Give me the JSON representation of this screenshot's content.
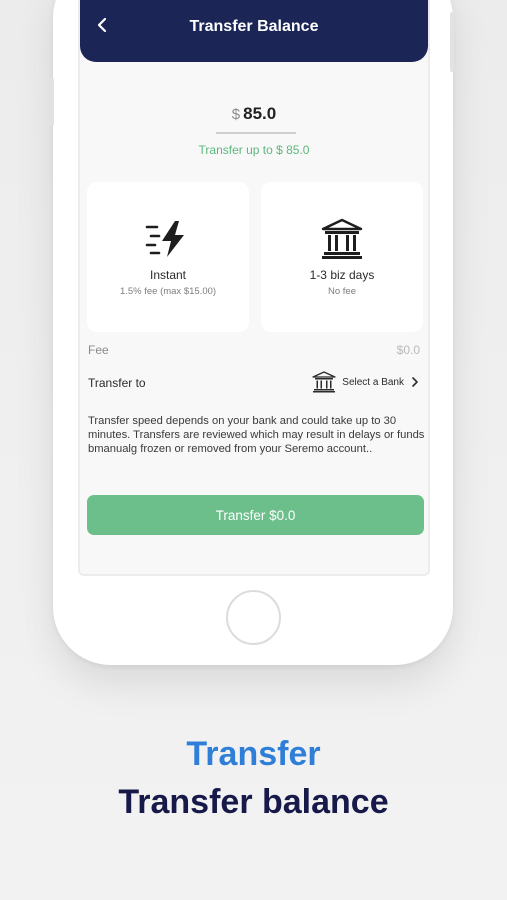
{
  "header": {
    "title": "Transfer Balance",
    "back_icon": "chevron-left-icon"
  },
  "amount": {
    "currency": "$",
    "value": "85.0",
    "limit_text": "Transfer up to $ 85.0"
  },
  "options": [
    {
      "icon": "lightning-speed-icon",
      "title": "Instant",
      "subtitle": "1.5% fee (max $15.00)"
    },
    {
      "icon": "bank-icon",
      "title": "1-3 biz days",
      "subtitle": "No fee"
    }
  ],
  "fee": {
    "label": "Fee",
    "value": "$0.0"
  },
  "transfer_to": {
    "label": "Transfer to",
    "select_label": "Select a Bank",
    "icon": "bank-icon"
  },
  "notice": "Transfer speed depends on your bank and could take up to 30 minutes. Transfers are reviewed which may result in delays or funds bmanualg frozen or removed from your Seremo account..",
  "transfer_button": {
    "label": "Transfer $0.0"
  },
  "captions": {
    "line1": "Transfer",
    "line2": "Transfer balance"
  },
  "colors": {
    "header": "#1b2657",
    "accent_green": "#6cbf8a",
    "caption_blue": "#2f7fd8",
    "caption_dark": "#171a49"
  }
}
